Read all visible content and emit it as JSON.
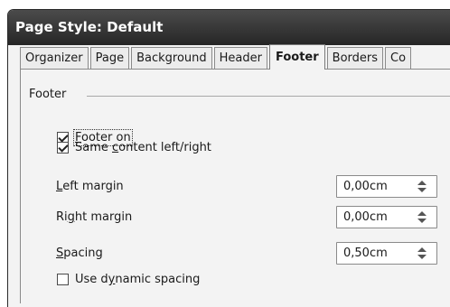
{
  "window": {
    "title": "Page Style: Default"
  },
  "tabs": [
    {
      "label": "Organizer"
    },
    {
      "label": "Page"
    },
    {
      "label": "Background"
    },
    {
      "label": "Header"
    },
    {
      "label": "Footer",
      "active": true
    },
    {
      "label": "Borders"
    },
    {
      "label": "Co"
    }
  ],
  "footer_group": {
    "title": "Footer",
    "footer_on": {
      "label_pre": "",
      "mnemonic": "F",
      "label_post": "ooter on",
      "checked": true
    },
    "same_content": {
      "label_pre": "Same ",
      "mnemonic": "c",
      "label_post": "ontent left/right",
      "checked": true
    },
    "left_margin": {
      "label_pre": "",
      "mnemonic": "L",
      "label_post": "eft margin",
      "value": "0,00cm"
    },
    "right_margin": {
      "label_pre": "Ri",
      "mnemonic": "g",
      "label_post": "ht margin",
      "value": "0,00cm"
    },
    "spacing": {
      "label_pre": "",
      "mnemonic": "S",
      "label_post": "pacing",
      "value": "0,50cm"
    },
    "dynamic_spacing": {
      "label_pre": "Use d",
      "mnemonic": "y",
      "label_post": "namic spacing",
      "checked": false
    }
  },
  "colors": {
    "titlebar_top": "#4b4b4b",
    "titlebar_bottom": "#262626",
    "dialog_bg": "#f3f3f3"
  },
  "icons": {
    "check": "checkmark",
    "spin": "spin-up-down-arrows"
  }
}
